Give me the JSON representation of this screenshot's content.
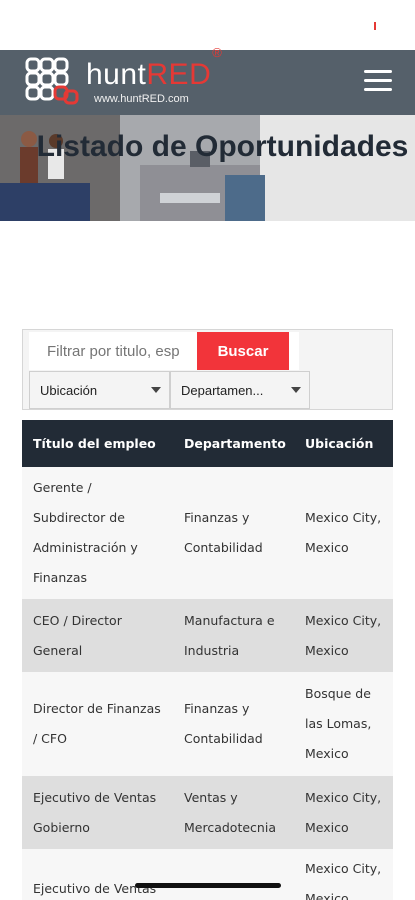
{
  "header": {
    "brand_prefix": "hunt",
    "brand_suffix": "RED",
    "registered_mark": "®",
    "url": "www.huntRED.com",
    "menu_icon": "hamburger-menu-icon",
    "colors": {
      "bar": "#55606a",
      "accent": "#e53935"
    }
  },
  "hero": {
    "title": "Listado de Oportunidades"
  },
  "filters": {
    "search_placeholder": "Filtrar por titulo, esp",
    "search_button": "Buscar",
    "location_select": "Ubicación",
    "department_select": "Departamen...",
    "button_color": "#f2343a"
  },
  "table": {
    "headers": [
      "Título del empleo",
      "Departamento",
      "Ubicación"
    ],
    "rows": [
      {
        "title": "Gerente /\nSubdirector de\nAdministración y\nFinanzas",
        "department": "Finanzas y\nContabilidad",
        "location": "Mexico City,\nMexico"
      },
      {
        "title": "CEO / Director\nGeneral",
        "department": "Manufactura e\nIndustria",
        "location": "Mexico City,\nMexico"
      },
      {
        "title": "Director de Finanzas\n/ CFO",
        "department": "Finanzas y\nContabilidad",
        "location": "Bosque de\nlas Lomas,\nMexico"
      },
      {
        "title": "Ejecutivo de Ventas\nGobierno",
        "department": "Ventas y\nMercadotecnia",
        "location": "Mexico City,\nMexico"
      },
      {
        "title": "Ejecutivo de Ventas",
        "department": "",
        "location": "Mexico City,\nMexico"
      }
    ],
    "header_color": "#222b36"
  }
}
